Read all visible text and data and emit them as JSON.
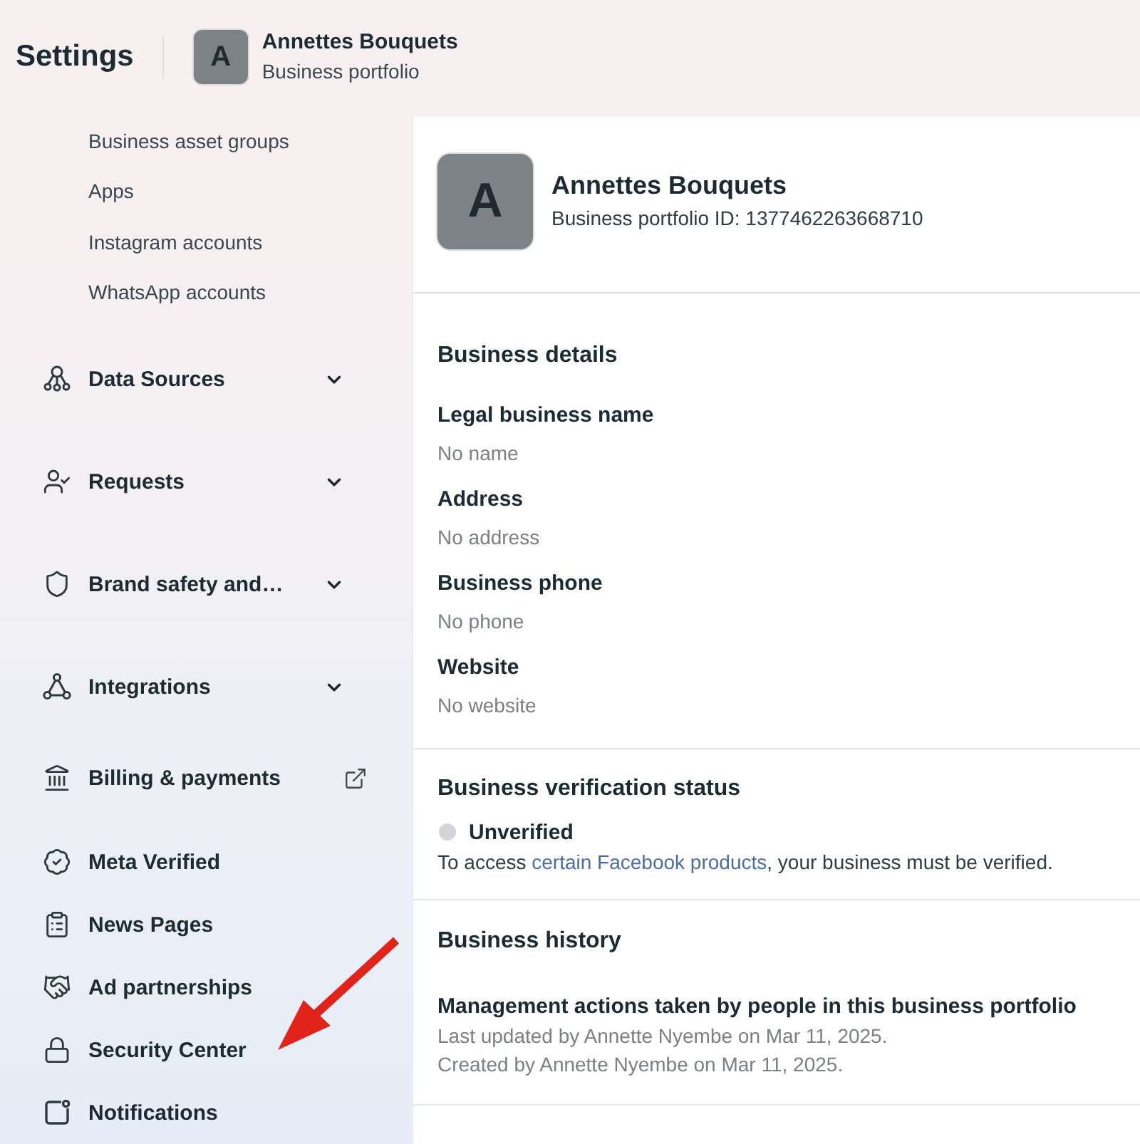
{
  "header": {
    "title": "Settings",
    "portfolio": {
      "initial": "A",
      "name": "Annettes Bouquets",
      "subtitle": "Business portfolio"
    }
  },
  "sidebar": {
    "subitems": [
      {
        "label": "Business asset groups"
      },
      {
        "label": "Apps"
      },
      {
        "label": "Instagram accounts"
      },
      {
        "label": "WhatsApp accounts"
      }
    ],
    "items": [
      {
        "label": "Data Sources",
        "kind": "expandable",
        "expanded": false
      },
      {
        "label": "Requests",
        "kind": "expandable",
        "expanded": false
      },
      {
        "label": "Brand safety and…",
        "kind": "expandable",
        "expanded": false
      },
      {
        "label": "Integrations",
        "kind": "expandable",
        "expanded": false
      },
      {
        "label": "Billing & payments",
        "kind": "external"
      },
      {
        "label": "Meta Verified",
        "kind": "link"
      },
      {
        "label": "News Pages",
        "kind": "link"
      },
      {
        "label": "Ad partnerships",
        "kind": "link"
      },
      {
        "label": "Security Center",
        "kind": "link"
      },
      {
        "label": "Notifications",
        "kind": "link"
      }
    ]
  },
  "profile": {
    "initial": "A",
    "name": "Annettes Bouquets",
    "id_line": "Business portfolio ID: 1377462263668710"
  },
  "business_details": {
    "title": "Business details",
    "fields": [
      {
        "label": "Legal business name",
        "value": "No name"
      },
      {
        "label": "Address",
        "value": "No address"
      },
      {
        "label": "Business phone",
        "value": "No phone"
      },
      {
        "label": "Website",
        "value": "No website"
      }
    ]
  },
  "verification": {
    "title": "Business verification status",
    "status": {
      "label": "Unverified",
      "verified": false
    },
    "message": {
      "before": "To access ",
      "link": "certain Facebook products",
      "after": ", your business must be verified."
    }
  },
  "history": {
    "title": "Business history",
    "entries": [
      {
        "heading": "Management actions taken by people in this business portfolio",
        "lines": [
          "Last updated by Annette Nyembe on Mar 11, 2025.",
          "Created by Annette Nyembe on Mar 11, 2025."
        ]
      }
    ]
  },
  "annotations": [
    {
      "kind": "arrow"
    }
  ]
}
